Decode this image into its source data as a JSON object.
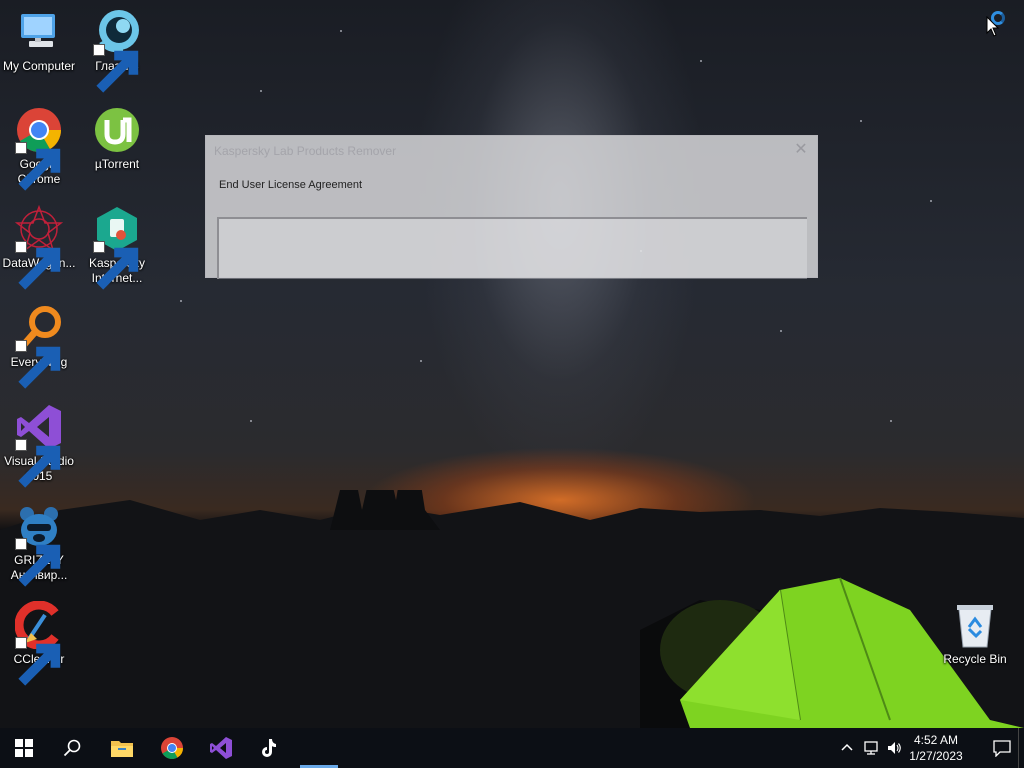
{
  "desktop": {
    "icons_left": [
      {
        "label": "My Computer",
        "icon": "computer-icon"
      },
      {
        "label": "Google Chrome",
        "icon": "chrome-icon"
      },
      {
        "label": "DataWagon...",
        "icon": "datawagon-icon"
      },
      {
        "label": "Everything",
        "icon": "everything-search-icon"
      },
      {
        "label": "Visual Studio 2015",
        "icon": "visual-studio-icon"
      },
      {
        "label": "GRIZZLY Антивир...",
        "icon": "grizzly-antivirus-icon"
      },
      {
        "label": "CCleaner",
        "icon": "ccleaner-icon"
      }
    ],
    "icons_col2": [
      {
        "label": "Глаз.ТВ",
        "icon": "glaz-tv-icon"
      },
      {
        "label": "µTorrent",
        "icon": "utorrent-icon"
      },
      {
        "label": "Kaspersky Internet...",
        "icon": "kaspersky-icon"
      }
    ],
    "recycle_bin": {
      "label": "Recycle Bin",
      "icon": "recycle-bin-icon"
    }
  },
  "dialog": {
    "title": "Kaspersky Lab Products Remover",
    "close_glyph": "✕",
    "heading": "End User License Agreement"
  },
  "taskbar": {
    "pinned": [
      "start-windows-icon",
      "search-icon",
      "file-explorer-icon",
      "chrome-icon",
      "visual-studio-icon",
      "tiktok-icon"
    ],
    "tray": [
      "chevron-up-icon",
      "network-icon",
      "volume-icon"
    ],
    "time": "4:52 AM",
    "date": "1/27/2023",
    "notification_icon": "action-center-icon"
  },
  "colors": {
    "taskbar": "#0c0f15",
    "accent": "#6aa9e8",
    "tent_green": "#7ed321"
  }
}
